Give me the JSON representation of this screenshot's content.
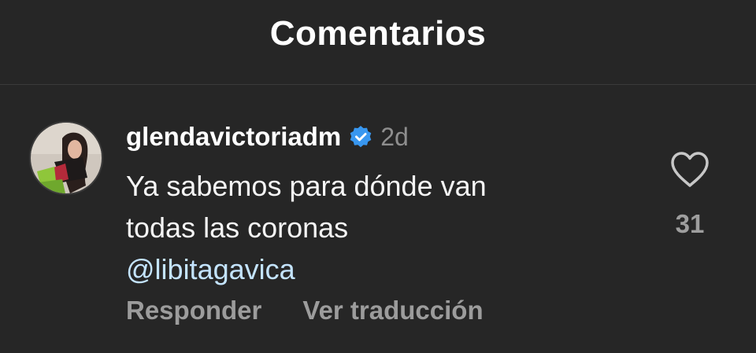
{
  "header": {
    "title": "Comentarios"
  },
  "comment": {
    "username": "glendavictoriadm",
    "verified_icon": "verified-badge-icon",
    "time": "2d",
    "text_lines": [
      "Ya sabemos para dónde van",
      "todas las coronas"
    ],
    "mention": "@libitagavica",
    "like_count": "31",
    "like_icon": "heart-outline-icon",
    "actions": {
      "reply": "Responder",
      "translate": "Ver traducción"
    }
  },
  "colors": {
    "background": "#262626",
    "text": "#f5f5f5",
    "muted": "#8e8e8e",
    "mention": "#c4e4ff",
    "verified": "#3897f0"
  }
}
